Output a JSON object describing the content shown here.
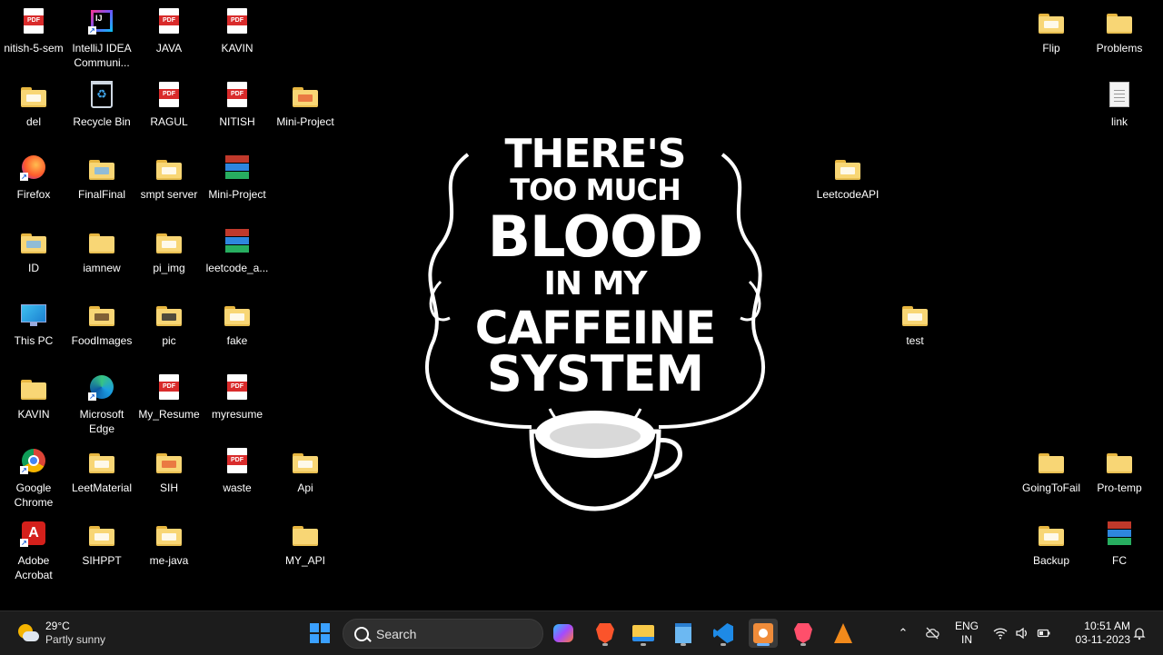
{
  "wallpaper": {
    "lines": [
      "THERE'S",
      "TOO MUCH",
      "BLOOD",
      "IN MY",
      "CAFFEINE",
      "SYSTEM"
    ]
  },
  "desktop_icons": [
    {
      "label": "nitish-5-sem",
      "type": "pdf"
    },
    {
      "label": "IntelliJ IDEA Communi...",
      "type": "intellij"
    },
    {
      "label": "JAVA",
      "type": "pdf"
    },
    {
      "label": "KAVIN",
      "type": "pdf"
    },
    {
      "label": "Flip",
      "type": "folder"
    },
    {
      "label": "Problems",
      "type": "folder"
    },
    {
      "label": "del",
      "type": "folder"
    },
    {
      "label": "Recycle Bin",
      "type": "recycle"
    },
    {
      "label": "RAGUL",
      "type": "pdf"
    },
    {
      "label": "NITISH",
      "type": "pdf"
    },
    {
      "label": "Mini-Project",
      "type": "folder"
    },
    {
      "label": "link",
      "type": "file"
    },
    {
      "label": "Firefox",
      "type": "firefox"
    },
    {
      "label": "FinalFinal",
      "type": "folder"
    },
    {
      "label": "smpt server",
      "type": "folder"
    },
    {
      "label": "Mini-Project",
      "type": "rar"
    },
    {
      "label": "LeetcodeAPI",
      "type": "folder"
    },
    {
      "label": "ID",
      "type": "folder"
    },
    {
      "label": "iamnew",
      "type": "folder"
    },
    {
      "label": "pi_img",
      "type": "folder"
    },
    {
      "label": "leetcode_a...",
      "type": "rar"
    },
    {
      "label": "This PC",
      "type": "thispc"
    },
    {
      "label": "FoodImages",
      "type": "folder"
    },
    {
      "label": "pic",
      "type": "folder"
    },
    {
      "label": "fake",
      "type": "folder"
    },
    {
      "label": "test",
      "type": "folder"
    },
    {
      "label": "KAVIN",
      "type": "folder"
    },
    {
      "label": "Microsoft Edge",
      "type": "edge"
    },
    {
      "label": "My_Resume",
      "type": "pdf"
    },
    {
      "label": "myresume",
      "type": "pdf"
    },
    {
      "label": "Google Chrome",
      "type": "chrome"
    },
    {
      "label": "LeetMaterial",
      "type": "folder"
    },
    {
      "label": "SIH",
      "type": "folder"
    },
    {
      "label": "waste",
      "type": "pdf"
    },
    {
      "label": "Api",
      "type": "folder"
    },
    {
      "label": "GoingToFail",
      "type": "folder"
    },
    {
      "label": "Pro-temp",
      "type": "folder"
    },
    {
      "label": "Adobe Acrobat",
      "type": "acrobat"
    },
    {
      "label": "SIHPPT",
      "type": "folder"
    },
    {
      "label": "me-java",
      "type": "folder"
    },
    {
      "label": "MY_API",
      "type": "folder"
    },
    {
      "label": "Backup",
      "type": "folder"
    },
    {
      "label": "FC",
      "type": "rar"
    }
  ],
  "taskbar": {
    "weather": {
      "temp": "29°C",
      "condition": "Partly sunny"
    },
    "search_placeholder": "Search",
    "language": {
      "line1": "ENG",
      "line2": "IN"
    },
    "clock": {
      "time": "10:51 AM",
      "date": "03-11-2023"
    },
    "pinned": [
      "copilot-icon",
      "brave-icon",
      "file-explorer-icon",
      "notepad-icon",
      "vscode-icon",
      "recorder-icon",
      "brave-beta-icon",
      "vlc-icon"
    ]
  },
  "colors": {
    "folder": "#f8d675",
    "pdf_red": "#d92b2b",
    "taskbar": "#1c1c1c",
    "accent": "#3aa0ff"
  }
}
